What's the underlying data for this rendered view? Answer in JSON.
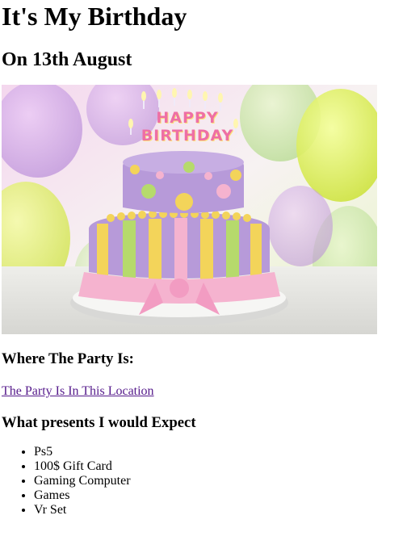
{
  "page": {
    "title": "It's My Birthday",
    "date_heading": "On 13th August",
    "image_alt": "Birthday cake",
    "cake_topper": "HAPPY BIRTHDAY",
    "location_heading": "Where The Party Is:",
    "location_link": "The Party Is In This Location",
    "presents_heading": "What presents I would Expect",
    "presents": [
      "Ps5",
      "100$ Gift Card",
      "Gaming Computer",
      "Games",
      "Vr Set"
    ]
  },
  "colors": {
    "link": "#551a8b",
    "cake_purple": "#b79ad9",
    "cake_pink": "#f5b3cf",
    "cake_yellow": "#f3d45a"
  }
}
